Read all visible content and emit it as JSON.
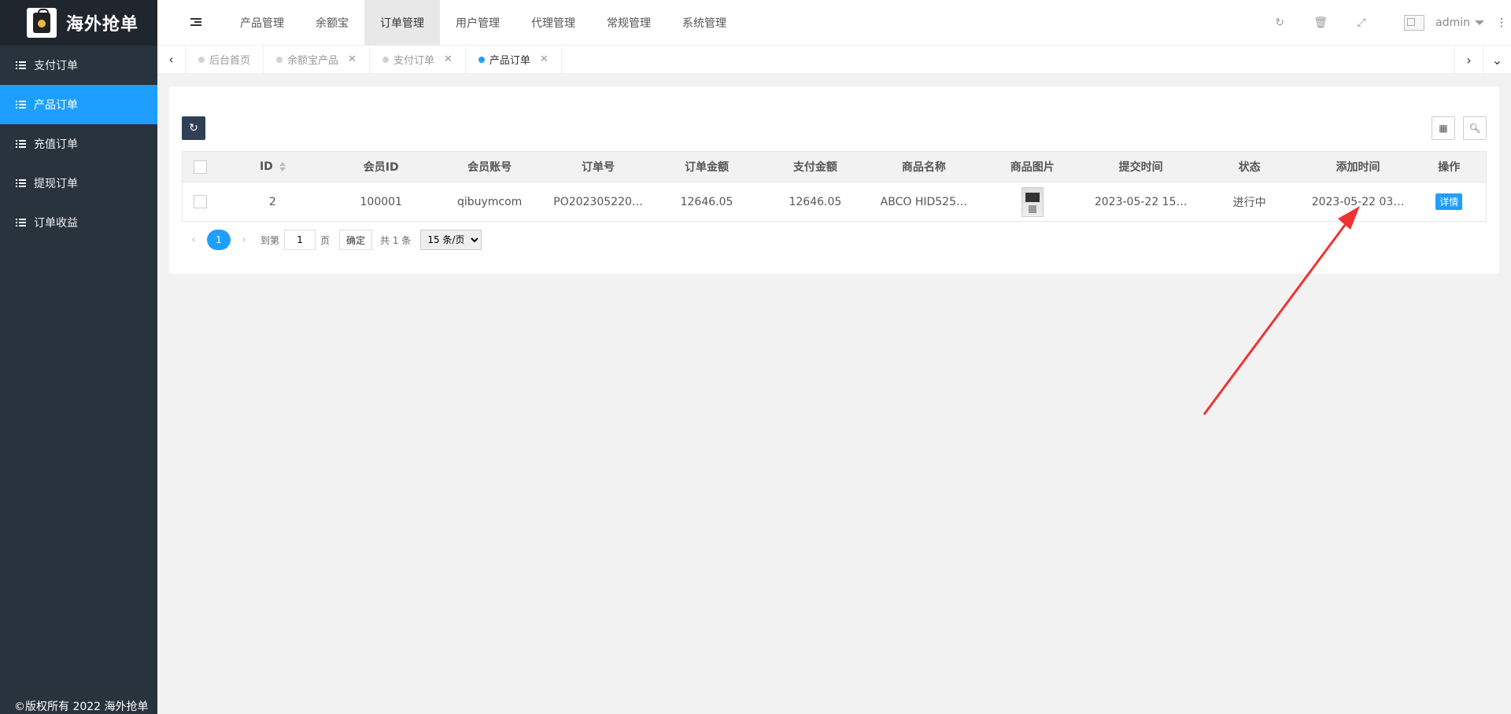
{
  "app": {
    "title": "海外抢单",
    "copyright": "©版权所有 2022 海外抢单"
  },
  "sidebar": {
    "items": [
      {
        "label": "支付订单",
        "active": false
      },
      {
        "label": "产品订单",
        "active": true
      },
      {
        "label": "充值订单",
        "active": false
      },
      {
        "label": "提现订单",
        "active": false
      },
      {
        "label": "订单收益",
        "active": false
      }
    ]
  },
  "header": {
    "nav": [
      "产品管理",
      "余额宝",
      "订单管理",
      "用户管理",
      "代理管理",
      "常规管理",
      "系统管理"
    ],
    "active_nav": "订单管理",
    "user": "admin"
  },
  "tabs": [
    {
      "label": "后台首页",
      "closable": false
    },
    {
      "label": "余额宝产品",
      "closable": true
    },
    {
      "label": "支付订单",
      "closable": true
    },
    {
      "label": "产品订单",
      "closable": true,
      "active": true
    }
  ],
  "table": {
    "columns": [
      "ID",
      "会员ID",
      "会员账号",
      "订单号",
      "订单金额",
      "支付金额",
      "商品名称",
      "商品图片",
      "提交时间",
      "状态",
      "添加时间",
      "操作"
    ],
    "rows": [
      {
        "id": "2",
        "member_id": "100001",
        "account": "qibuymcom",
        "order_no": "PO202305220…",
        "order_amount": "12646.05",
        "pay_amount": "12646.05",
        "product_name": "ABCO HID525…",
        "submit_time": "2023-05-22 15…",
        "status": "进行中",
        "add_time": "2023-05-22 03…",
        "action": "详情"
      }
    ]
  },
  "pager": {
    "current": "1",
    "goto_label": "到第",
    "goto_value": "1",
    "page_label": "页",
    "confirm": "确定",
    "total": "共 1 条",
    "page_size": "15 条/页"
  },
  "colors": {
    "accent": "#1e9fff",
    "sidebar": "#28333e",
    "annotation": "#ee3333"
  }
}
